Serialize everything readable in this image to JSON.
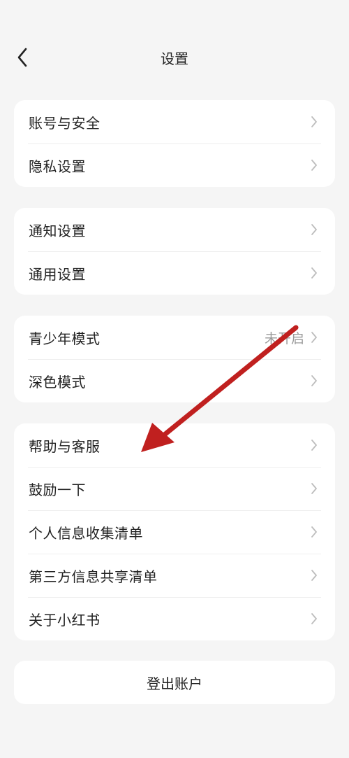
{
  "header": {
    "title": "设置"
  },
  "groups": [
    {
      "items": [
        {
          "label": "账号与安全",
          "value": ""
        },
        {
          "label": "隐私设置",
          "value": ""
        }
      ]
    },
    {
      "items": [
        {
          "label": "通知设置",
          "value": ""
        },
        {
          "label": "通用设置",
          "value": ""
        }
      ]
    },
    {
      "items": [
        {
          "label": "青少年模式",
          "value": "未开启"
        },
        {
          "label": "深色模式",
          "value": ""
        }
      ]
    },
    {
      "items": [
        {
          "label": "帮助与客服",
          "value": ""
        },
        {
          "label": "鼓励一下",
          "value": ""
        },
        {
          "label": "个人信息收集清单",
          "value": ""
        },
        {
          "label": "第三方信息共享清单",
          "value": ""
        },
        {
          "label": "关于小红书",
          "value": ""
        }
      ]
    }
  ],
  "logout": {
    "label": "登出账户"
  },
  "colors": {
    "background": "#f5f5f5",
    "card": "#ffffff",
    "annotation_arrow": "#c0201f"
  }
}
